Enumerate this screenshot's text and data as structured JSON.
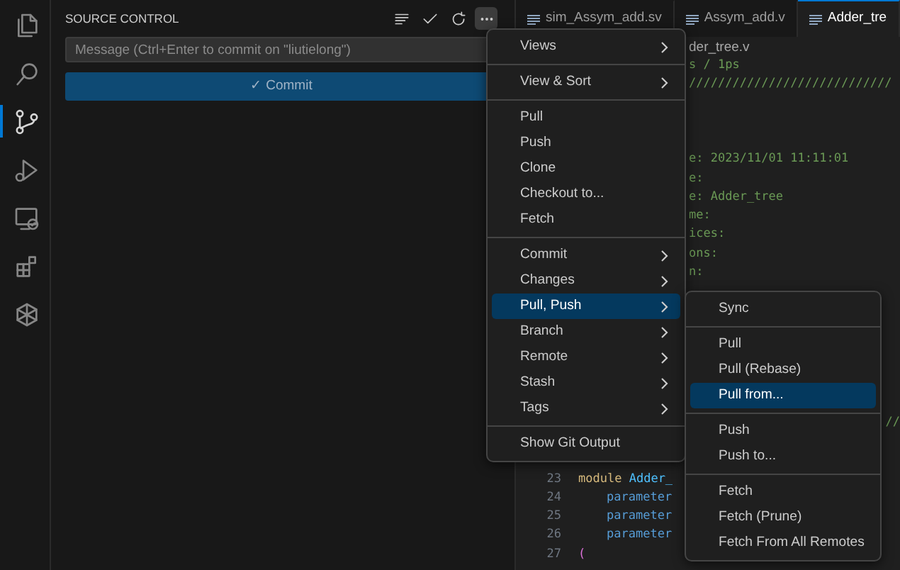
{
  "activity_bar": [
    {
      "selected": false
    },
    {
      "selected": false
    },
    {
      "selected": true
    },
    {
      "selected": false
    },
    {
      "selected": false
    },
    {
      "selected": false
    },
    {
      "selected": false
    }
  ],
  "sidebar": {
    "title": "SOURCE CONTROL",
    "actions": [
      {
        "selected": false
      },
      {
        "selected": false
      },
      {
        "selected": false
      },
      {
        "selected": true
      }
    ],
    "message": {
      "placeholder": "Message (Ctrl+Enter to commit on \"liutielong\")"
    },
    "commit_button": {
      "icon": "✓",
      "label": "Commit"
    }
  },
  "tabs": [
    {
      "label": "sim_Assym_add.sv",
      "selected": false
    },
    {
      "label": "Assym_add.v",
      "selected": false
    },
    {
      "label": "Adder_tre",
      "selected": true
    }
  ],
  "editor": {
    "breadcrumb": "der_tree.v",
    "lines": [
      {
        "kind": "clipped",
        "text": "s / 1ps"
      },
      {
        "kind": "clipped",
        "text": "////////////////////////////"
      },
      {
        "kind": "clipped",
        "text": "e: 2023/11/01 11:11:01"
      },
      {
        "kind": "clipped",
        "text": "e:"
      },
      {
        "kind": "clipped",
        "text": "e: Adder_tree"
      },
      {
        "kind": "clipped",
        "text": "me:"
      },
      {
        "kind": "clipped",
        "text": "ices:"
      },
      {
        "kind": "clipped",
        "text": "ons:"
      },
      {
        "kind": "clipped",
        "text": "n:"
      },
      {
        "kind": "right",
        "text": "//"
      },
      {
        "kind": "numbered",
        "number": "23",
        "keyword": "module",
        "text": "Adder_"
      },
      {
        "kind": "numbered",
        "number": "24",
        "keyword": "parameter"
      },
      {
        "kind": "numbered",
        "number": "25",
        "keyword": "parameter"
      },
      {
        "kind": "numbered",
        "number": "26",
        "keyword": "parameter"
      },
      {
        "kind": "numbered",
        "number": "27",
        "bracket": "("
      }
    ]
  },
  "menu": {
    "groups": [
      [
        {
          "label": "Views",
          "submenu": true,
          "selected": false
        }
      ],
      [
        {
          "label": "View & Sort",
          "submenu": true,
          "selected": false
        }
      ],
      [
        {
          "label": "Pull",
          "submenu": false,
          "selected": false
        },
        {
          "label": "Push",
          "submenu": false,
          "selected": false
        },
        {
          "label": "Clone",
          "submenu": false,
          "selected": false
        },
        {
          "label": "Checkout to...",
          "submenu": false,
          "selected": false
        },
        {
          "label": "Fetch",
          "submenu": false,
          "selected": false
        }
      ],
      [
        {
          "label": "Commit",
          "submenu": true,
          "selected": false
        },
        {
          "label": "Changes",
          "submenu": true,
          "selected": false
        },
        {
          "label": "Pull, Push",
          "submenu": true,
          "selected": true
        },
        {
          "label": "Branch",
          "submenu": true,
          "selected": false
        },
        {
          "label": "Remote",
          "submenu": true,
          "selected": false
        },
        {
          "label": "Stash",
          "submenu": true,
          "selected": false
        },
        {
          "label": "Tags",
          "submenu": true,
          "selected": false
        }
      ],
      [
        {
          "label": "Show Git Output",
          "submenu": false,
          "selected": false
        }
      ]
    ]
  },
  "submenu": {
    "groups": [
      [
        {
          "label": "Sync",
          "selected": false
        }
      ],
      [
        {
          "label": "Pull",
          "selected": false
        },
        {
          "label": "Pull (Rebase)",
          "selected": false
        },
        {
          "label": "Pull from...",
          "selected": true
        }
      ],
      [
        {
          "label": "Push",
          "selected": false
        },
        {
          "label": "Push to...",
          "selected": false
        }
      ],
      [
        {
          "label": "Fetch",
          "selected": false
        },
        {
          "label": "Fetch (Prune)",
          "selected": false
        },
        {
          "label": "Fetch From All Remotes",
          "selected": false
        }
      ]
    ]
  }
}
